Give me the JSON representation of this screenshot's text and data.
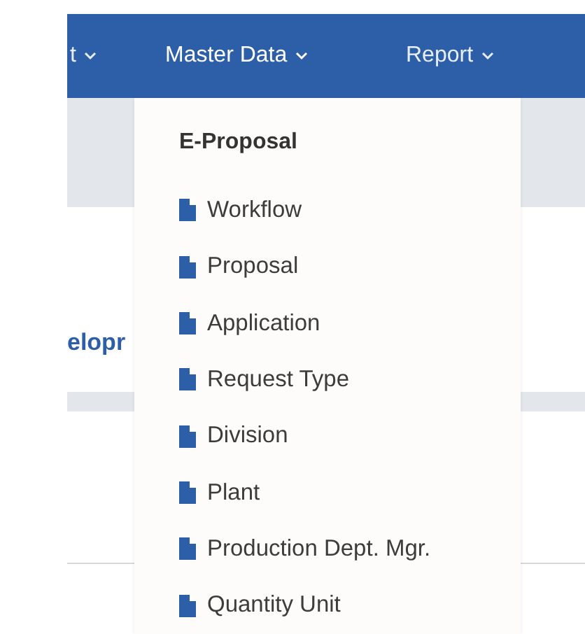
{
  "navbar": {
    "items": [
      {
        "label": "t",
        "expanded": false
      },
      {
        "label": "Master Data",
        "expanded": true
      },
      {
        "label": "Report",
        "expanded": false
      }
    ]
  },
  "dropdown": {
    "header": "E-Proposal",
    "items": [
      {
        "label": "Workflow"
      },
      {
        "label": "Proposal"
      },
      {
        "label": "Application"
      },
      {
        "label": "Request Type"
      },
      {
        "label": "Division"
      },
      {
        "label": "Plant"
      },
      {
        "label": "Production Dept. Mgr."
      },
      {
        "label": "Quantity Unit"
      }
    ]
  },
  "page": {
    "heading_fragment": "elopr"
  }
}
